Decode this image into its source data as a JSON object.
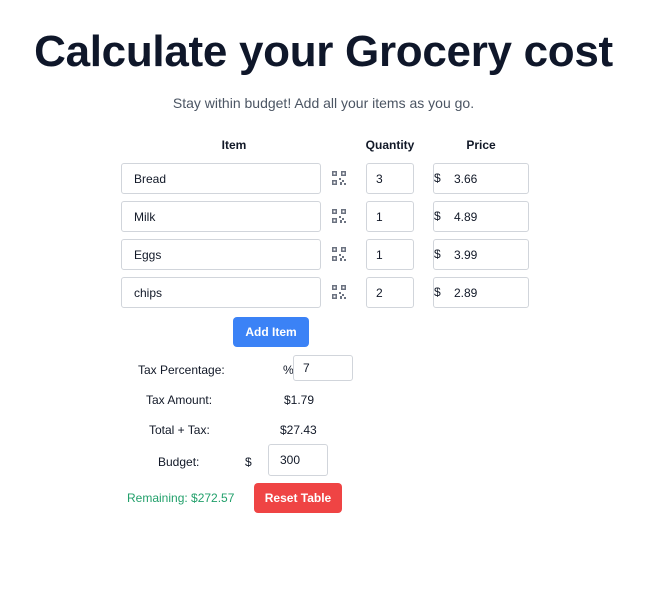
{
  "header": {
    "title": "Calculate your Grocery cost",
    "subtitle": "Stay within budget! Add all your items as you go."
  },
  "table": {
    "columns": {
      "item": "Item",
      "quantity": "Quantity",
      "price": "Price"
    },
    "currency_symbol": "$",
    "rows": [
      {
        "item": "Bread",
        "quantity": "3",
        "price": "3.66"
      },
      {
        "item": "Milk",
        "quantity": "1",
        "price": "4.89"
      },
      {
        "item": "Eggs",
        "quantity": "1",
        "price": "3.99"
      },
      {
        "item": "chips",
        "quantity": "2",
        "price": "2.89"
      }
    ],
    "row_icon": "qr-code-icon"
  },
  "actions": {
    "add_item_label": "Add Item",
    "reset_label": "Reset Table"
  },
  "summary": {
    "tax_percentage_label": "Tax Percentage:",
    "percent_symbol": "%",
    "tax_percentage_value": "7",
    "tax_amount_label": "Tax Amount:",
    "tax_amount_value": "$1.79",
    "total_label": "Total + Tax:",
    "total_value": "$27.43",
    "budget_label": "Budget:",
    "budget_currency": "$",
    "budget_value": "300",
    "remaining_text": "Remaining: $272.57"
  },
  "colors": {
    "primary_button": "#3b82f6",
    "danger_button": "#ef4444",
    "remaining_text": "#22a06b",
    "title": "#0f172a"
  }
}
